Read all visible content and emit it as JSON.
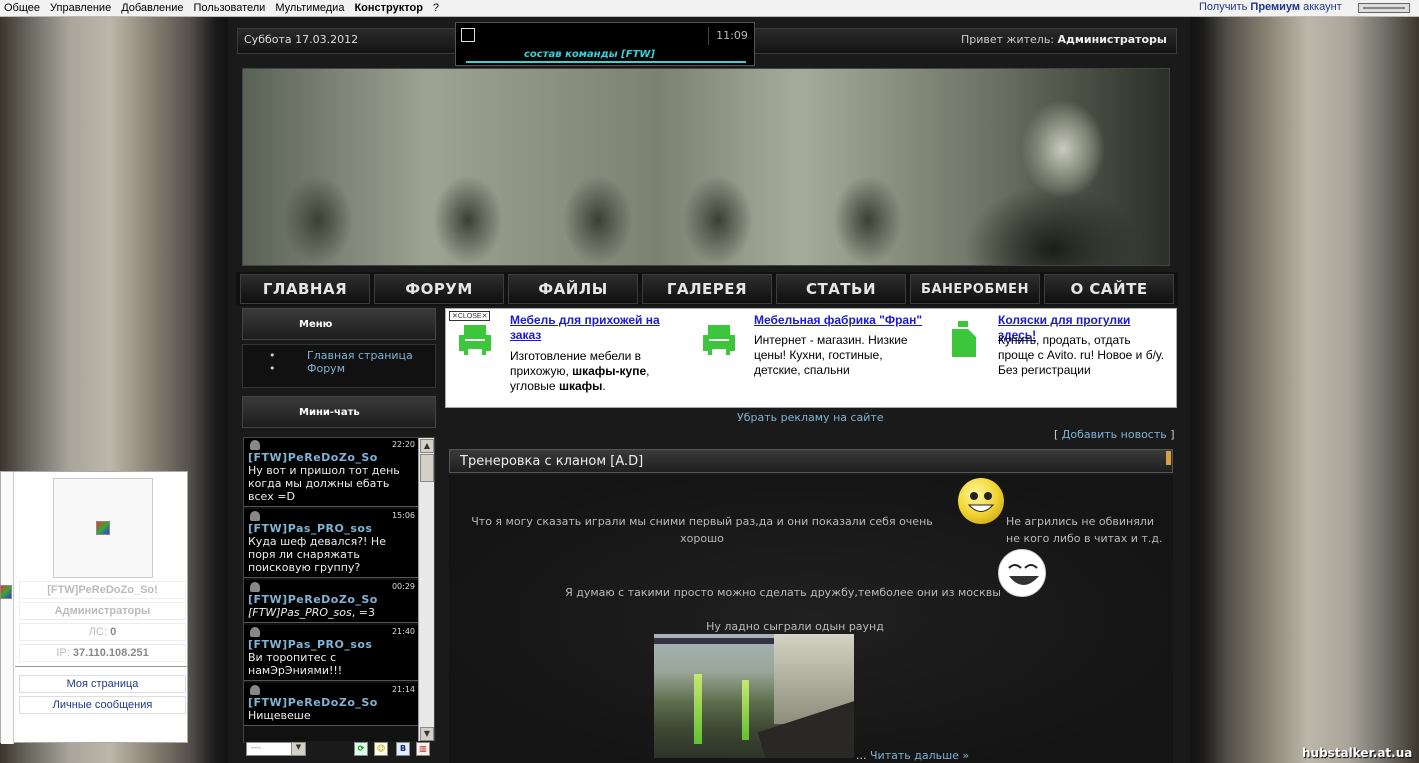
{
  "adminbar": {
    "menu": [
      "Общее",
      "Управление",
      "Добавление",
      "Пользователи",
      "Мультимедиа",
      "Конструктор",
      "?"
    ],
    "premium_prefix": "Получить",
    "premium_bold": "Премиум",
    "premium_suffix": "аккаунт"
  },
  "top": {
    "date": "Суббота 17.03.2012",
    "clock": "11:09",
    "marquee": "состав команды [FTW]",
    "hello_prefix": "Привет житель:",
    "hello_name": "Администраторы"
  },
  "nav": [
    "ГЛАВНАЯ",
    "ФОРУМ",
    "ФАЙЛЫ",
    "ГАЛЕРЕЯ",
    "СТАТЬИ",
    "БАНЕРОБМЕН",
    "О САЙТЕ"
  ],
  "menu_block": {
    "title": "Меню",
    "items": [
      "Главная страница",
      "Форум"
    ]
  },
  "chat_block": {
    "title": "Мини-чать"
  },
  "chat": [
    {
      "time": "22:20",
      "nick": "[FTW]PeReDoZo_So",
      "text": "Ну вот и пришол тот день когда мы должны ебать всех =D"
    },
    {
      "time": "15:06",
      "nick": "[FTW]Pas_PRO_sos",
      "text": "Куда шеф девался?! Не поря ли снаряжать поисковую группу?"
    },
    {
      "time": "00:29",
      "nick": "[FTW]PeReDoZo_So",
      "quote": "[FTW]Pas_PRO_sos",
      "text": ", =3"
    },
    {
      "time": "21:40",
      "nick": "[FTW]Pas_PRO_sos",
      "text": "Ви торопитес с намЭрЭниями!!!"
    },
    {
      "time": "21:14",
      "nick": "[FTW]PeReDoZo_So",
      "text": "Нищевеше"
    }
  ],
  "chat_select": "---",
  "ads": {
    "close": "✕CLOSE✕",
    "items": [
      {
        "title": "Мебель для прихожей на заказ",
        "desc_parts": [
          "Изготовление мебели в прихожую, ",
          "шкафы-купе",
          ", угловые ",
          "шкафы",
          "."
        ]
      },
      {
        "title": "Мебельная фабрика \"Фран\"",
        "desc": "Интернет - магазин. Низкие цены! Кухни, гостиные, детские, спальни"
      },
      {
        "title": "Коляски для прогулки здесь!",
        "desc": "Купить, продать, отдать проще с Avito. ru! Новое и б/у. Без регистрации"
      }
    ],
    "remove": "Убрать рекламу на сайте"
  },
  "add_news": "Добавить новость",
  "news": {
    "title": "Тренеровка с кланом [A.D]",
    "p1": "Что я могу сказать играли мы сними первый раз,да и они показали себя очень хорошо",
    "p1b": "Не агрились не обвиняли не кого либо в читах и т.д.",
    "p2": "Я думаю с такими просто можно сделать дружбу,темболее они из москвы",
    "p3": "Ну ладно сыграли одын раунд",
    "read_more_prefix": "...",
    "read_more": "Читать дальше »"
  },
  "user_panel": {
    "name": "[FTW]PeReDoZo_So!",
    "group": "Администраторы",
    "ls_label": "ЛС:",
    "ls_value": "0",
    "ip_label": "IP:",
    "ip_value": "37.110.108.251",
    "my_page": "Моя страница",
    "messages": "Личные сообщения"
  },
  "site": "hubstalker.at.ua",
  "colors": {
    "link": "#7fb3d5",
    "ad_link": "#1a1ad0",
    "ad_icon": "#3cc63c"
  }
}
